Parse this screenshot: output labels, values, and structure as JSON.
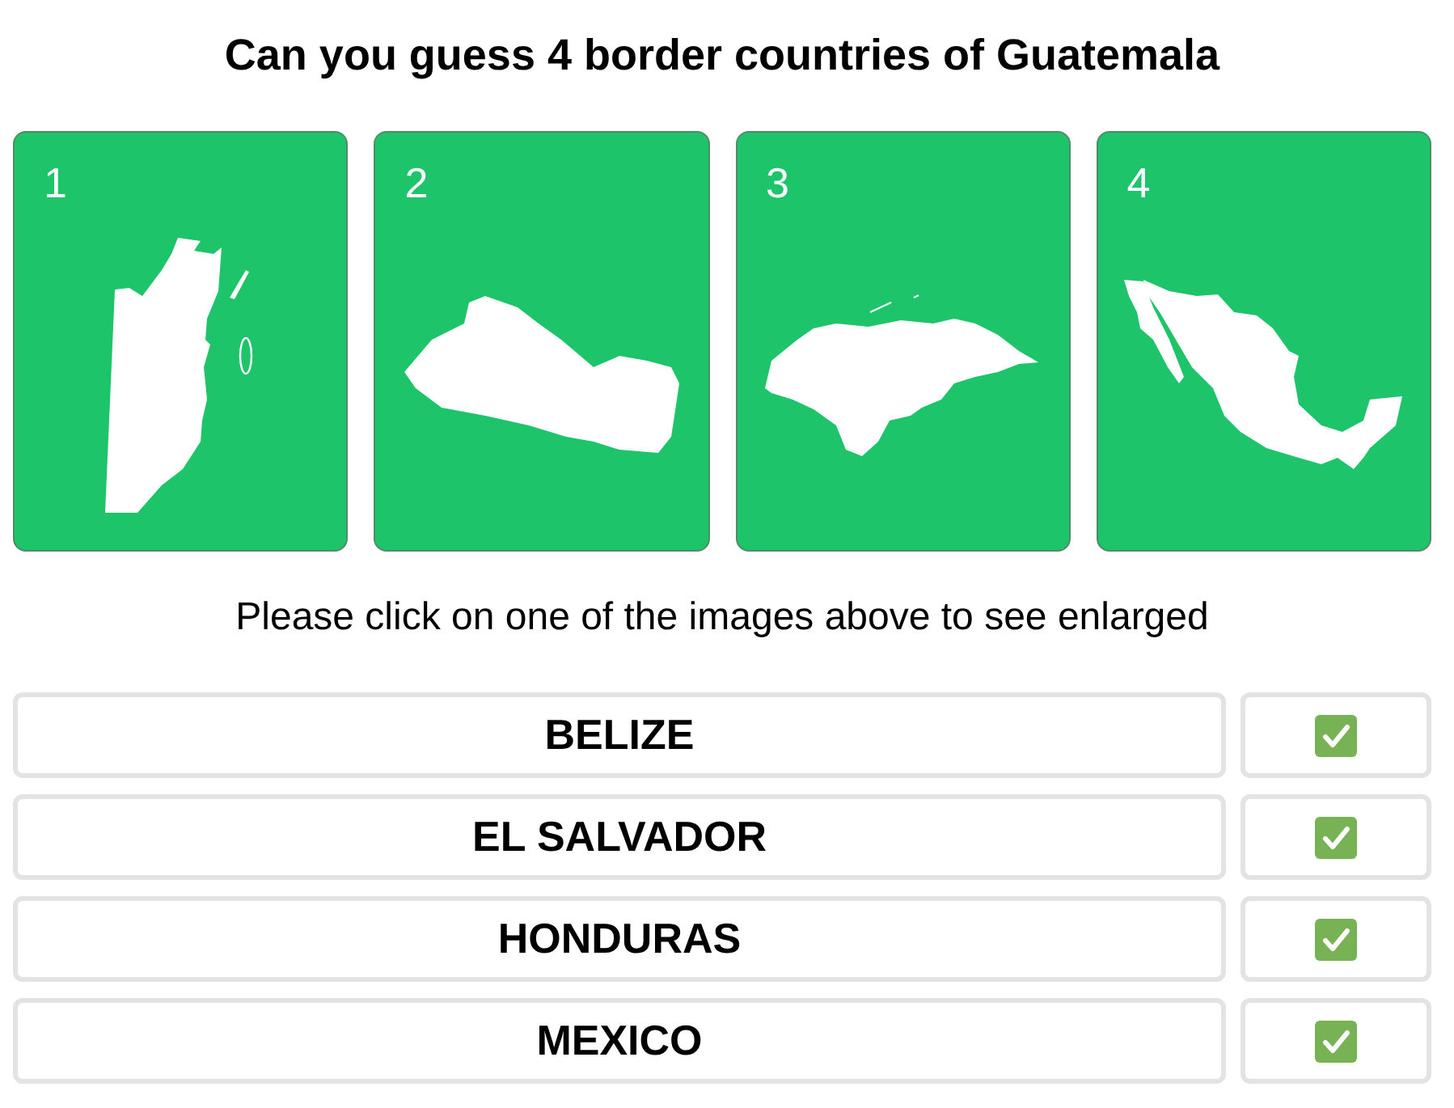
{
  "title": "Can you guess 4 border countries of Guatemala",
  "cards": [
    {
      "number": "1",
      "kind": "belize"
    },
    {
      "number": "2",
      "kind": "elsalvador"
    },
    {
      "number": "3",
      "kind": "honduras"
    },
    {
      "number": "4",
      "kind": "mexico"
    }
  ],
  "instruction": "Please click on one of the images above to see enlarged",
  "answers": [
    {
      "label": "BELIZE",
      "checked": true
    },
    {
      "label": "EL SALVADOR",
      "checked": true
    },
    {
      "label": "HONDURAS",
      "checked": true
    },
    {
      "label": "MEXICO",
      "checked": true
    }
  ]
}
